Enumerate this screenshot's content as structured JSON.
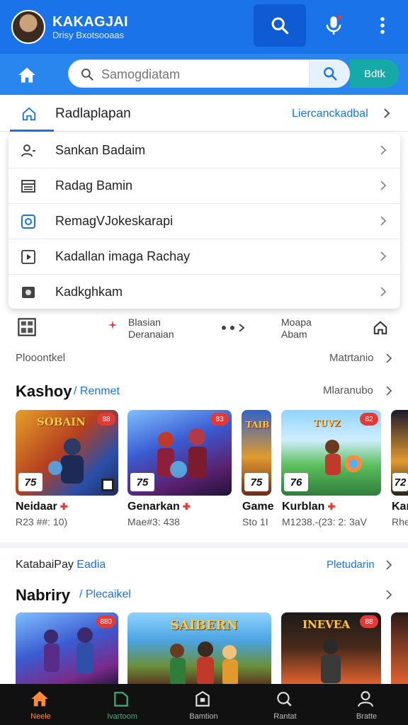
{
  "header": {
    "title": "KAKAGJAI",
    "subtitle": "Drisy Bxotsooaas",
    "search_icon": "search-icon",
    "mic_icon": "mic-icon",
    "more_icon": "more-vert-icon"
  },
  "search": {
    "placeholder": "Samogdiatam",
    "action_label": "Bdtk"
  },
  "tabbar": {
    "label": "Radlaplapan",
    "link": "Liercanckadbal"
  },
  "menu": {
    "items": [
      {
        "label": "Sankan Badaim",
        "icon": "user-search-icon"
      },
      {
        "label": "Radag Bamin",
        "icon": "list-icon"
      },
      {
        "label": "RemagVJokeskarapi",
        "icon": "camera-circle-icon"
      },
      {
        "label": "Kadallan imaga Rachay",
        "icon": "play-icon"
      },
      {
        "label": "Kadkghkam",
        "icon": "photo-icon"
      }
    ]
  },
  "infostrip": {
    "left_line1": "Blasian",
    "left_line2": "Deranaian",
    "right_line1": "Moapa",
    "right_line2": "Abam"
  },
  "row1": {
    "left": "Plooontkel",
    "right": "Matrtanio"
  },
  "section1": {
    "title": "Kashoy",
    "sub": "/ Renmet",
    "link": "Mlaranubo",
    "cards": [
      {
        "name": "Neidaar",
        "meta": "R23 ##: 10)",
        "badge": "88",
        "rating": "75",
        "art": "SOBAIN"
      },
      {
        "name": "Genarkan",
        "meta": "Mae#3: 438",
        "badge": "83",
        "rating": "75",
        "art": ""
      },
      {
        "name": "Game",
        "meta": "Sto 1I",
        "badge": "",
        "rating": "75",
        "art": "TAIB"
      },
      {
        "name": "Kurblan",
        "meta": "M1238.-(23: 2: 3aV",
        "badge": "82",
        "rating": "76",
        "art": "TUVZ"
      },
      {
        "name": "Kar",
        "meta": "Rhe",
        "badge": "",
        "rating": "72",
        "art": ""
      }
    ]
  },
  "section2": {
    "row_left": "KatabaiPay",
    "row_left_sub": "Eadia",
    "row_right": "Pletudarin",
    "title": "Nabriry",
    "sub": "/ Plecaikel",
    "cards": [
      {
        "badge": "880",
        "art": ""
      },
      {
        "badge": "",
        "art": "SAIBERN"
      },
      {
        "badge": "88",
        "art": "INEVEA"
      }
    ]
  },
  "bottomnav": {
    "items": [
      {
        "label": "Neele",
        "icon": "home-icon",
        "active": true
      },
      {
        "label": "Ivartoom",
        "icon": "store-icon",
        "active": false
      },
      {
        "label": "Bamtion",
        "icon": "bag-icon",
        "active": false
      },
      {
        "label": "Rantat",
        "icon": "search-icon",
        "active": false
      },
      {
        "label": "Bratte",
        "icon": "person-icon",
        "active": false
      }
    ]
  },
  "colors": {
    "primary": "#1a73e8",
    "search_row": "#2a86ef",
    "accent_teal": "#15a9a7",
    "badge_red": "#e53935",
    "nav_active": "#ff8a3d"
  }
}
